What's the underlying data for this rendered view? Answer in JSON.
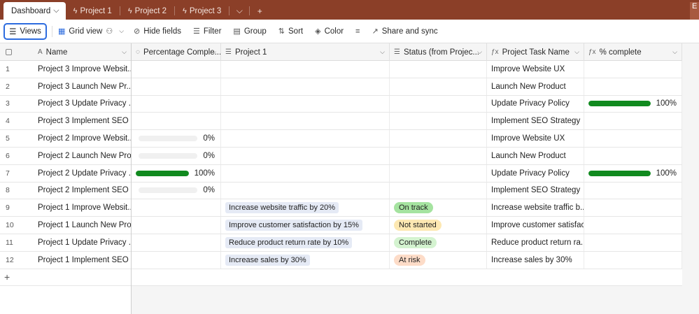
{
  "colors": {
    "tabbar": "#8b3f28",
    "accent": "#2d6cdf",
    "progress": "#118a1f"
  },
  "tabs": [
    {
      "label": "Dashboard",
      "icon": "chevron-down-icon",
      "active": true
    },
    {
      "label": "Project 1",
      "icon": "bolt-icon"
    },
    {
      "label": "Project 2",
      "icon": "bolt-icon"
    },
    {
      "label": "Project 3",
      "icon": "bolt-icon"
    }
  ],
  "toolbar": {
    "views": "Views",
    "grid_view": "Grid view",
    "hide_fields": "Hide fields",
    "filter": "Filter",
    "group": "Group",
    "sort": "Sort",
    "color": "Color",
    "share": "Share and sync"
  },
  "columns": {
    "name": "Name",
    "percentage": "Percentage Comple...",
    "project1": "Project 1",
    "status": "Status (from Projec...",
    "task": "Project Task Name",
    "complete": "% complete"
  },
  "rows": [
    {
      "num": "1",
      "name": "Project 3 Improve Websit...",
      "pct": null,
      "pct_label": "",
      "project1": "",
      "status": "",
      "task": "Improve Website UX",
      "complete": null,
      "complete_label": ""
    },
    {
      "num": "2",
      "name": "Project 3 Launch New Pr...",
      "pct": null,
      "pct_label": "",
      "project1": "",
      "status": "",
      "task": "Launch New Product",
      "complete": null,
      "complete_label": ""
    },
    {
      "num": "3",
      "name": "Project 3 Update Privacy ...",
      "pct": null,
      "pct_label": "",
      "project1": "",
      "status": "",
      "task": "Update Privacy Policy",
      "complete": 1.0,
      "complete_label": "100%"
    },
    {
      "num": "4",
      "name": "Project 3 Implement SEO ...",
      "pct": null,
      "pct_label": "",
      "project1": "",
      "status": "",
      "task": "Implement SEO Strategy",
      "complete": null,
      "complete_label": ""
    },
    {
      "num": "5",
      "name": "Project 2 Improve Websit...",
      "pct": 0,
      "pct_label": "0%",
      "project1": "",
      "status": "",
      "task": "Improve Website UX",
      "complete": null,
      "complete_label": ""
    },
    {
      "num": "6",
      "name": "Project 2 Launch New Pro...",
      "pct": 0,
      "pct_label": "0%",
      "project1": "",
      "status": "",
      "task": "Launch New Product",
      "complete": null,
      "complete_label": ""
    },
    {
      "num": "7",
      "name": "Project 2 Update Privacy ...",
      "pct": 1.0,
      "pct_label": "100%",
      "project1": "",
      "status": "",
      "task": "Update Privacy Policy",
      "complete": 1.0,
      "complete_label": "100%"
    },
    {
      "num": "8",
      "name": "Project 2 Implement SEO ...",
      "pct": 0,
      "pct_label": "0%",
      "project1": "",
      "status": "",
      "task": "Implement SEO Strategy",
      "complete": null,
      "complete_label": ""
    },
    {
      "num": "9",
      "name": "Project 1 Improve Websit...",
      "pct": null,
      "pct_label": "",
      "project1": "Increase website traffic by 20%",
      "status": "On track",
      "status_color": "#a5e3a0",
      "task": "Increase website traffic b...",
      "complete": null,
      "complete_label": ""
    },
    {
      "num": "10",
      "name": "Project 1 Launch New Pro...",
      "pct": null,
      "pct_label": "",
      "project1": "Improve customer satisfaction by 15%",
      "status": "Not started",
      "status_color": "#fde8b2",
      "task": "Improve customer satisfac...",
      "complete": null,
      "complete_label": ""
    },
    {
      "num": "11",
      "name": "Project 1 Update Privacy ...",
      "pct": null,
      "pct_label": "",
      "project1": "Reduce product return rate by 10%",
      "status": "Complete",
      "status_color": "#d4f3d0",
      "task": "Reduce product return ra...",
      "complete": null,
      "complete_label": ""
    },
    {
      "num": "12",
      "name": "Project 1 Implement SEO ...",
      "pct": null,
      "pct_label": "",
      "project1": "Increase sales by 30%",
      "status": "At risk",
      "status_color": "#fddcc8",
      "task": "Increase sales by 30%",
      "complete": null,
      "complete_label": ""
    }
  ]
}
